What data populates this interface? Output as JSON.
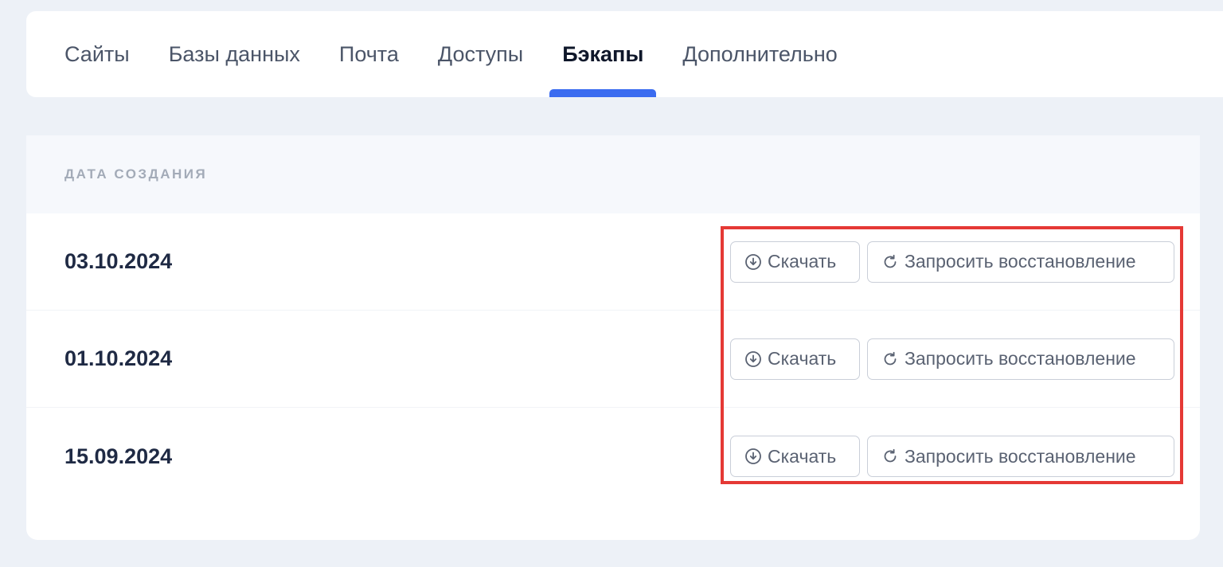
{
  "tabs": [
    {
      "label": "Сайты",
      "active": false
    },
    {
      "label": "Базы данных",
      "active": false
    },
    {
      "label": "Почта",
      "active": false
    },
    {
      "label": "Доступы",
      "active": false
    },
    {
      "label": "Бэкапы",
      "active": true
    },
    {
      "label": "Дополнительно",
      "active": false
    }
  ],
  "table": {
    "column_header": "ДАТА СОЗДАНИЯ",
    "rows": [
      {
        "date": "03.10.2024",
        "download_label": "Скачать",
        "restore_label": "Запросить восстановление"
      },
      {
        "date": "01.10.2024",
        "download_label": "Скачать",
        "restore_label": "Запросить восстановление"
      },
      {
        "date": "15.09.2024",
        "download_label": "Скачать",
        "restore_label": "Запросить восстановление"
      }
    ]
  },
  "icons": {
    "download": "download-circle-icon",
    "restore": "refresh-icon"
  },
  "colors": {
    "accent": "#3b6cf0",
    "highlight": "#e53935",
    "background": "#edf1f7"
  }
}
